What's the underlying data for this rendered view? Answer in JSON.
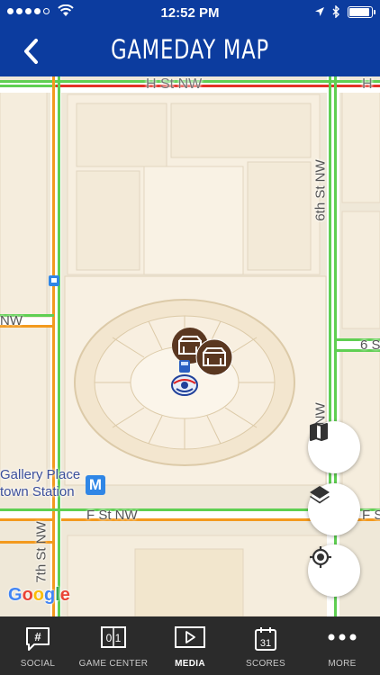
{
  "status_bar": {
    "time": "12:52 PM",
    "signal_dots_filled": 4,
    "signal_dots_total": 5,
    "battery_level": 0.9
  },
  "header": {
    "title": "GAMEDAY MAP",
    "back_icon": "chevron-left-icon",
    "background_color": "#0c3c9f"
  },
  "map": {
    "street_labels": {
      "h_st_left": "H St NW",
      "h_st_right": "H",
      "sixth_st": "6th St NW",
      "sixth_st_lower": "6th St NW",
      "sixth_st_right": "6 S",
      "nw_left": "NW",
      "f_st": "F St NW",
      "f_st_right": "F S",
      "seventh_st": "7th St NW",
      "gallery_place_1": "Gallery Place",
      "gallery_place_2": "town Station"
    },
    "metro_icon_label": "M",
    "google_logo": "Google",
    "buttons": [
      {
        "name": "map-view-button",
        "icon": "map-icon"
      },
      {
        "name": "layers-button",
        "icon": "layers-icon"
      },
      {
        "name": "my-location-button",
        "icon": "crosshair-icon"
      }
    ],
    "markers": [
      "concession-icon",
      "concession-icon",
      "team-logo-icon"
    ]
  },
  "tab_bar": {
    "tabs": [
      {
        "label": "SOCIAL",
        "icon": "hashtag-bubble-icon",
        "active": false
      },
      {
        "label": "GAME CENTER",
        "icon": "scoreboard-icon",
        "icon_text": "0 1",
        "active": false
      },
      {
        "label": "MEDIA",
        "icon": "play-icon",
        "active": true
      },
      {
        "label": "SCORES",
        "icon": "calendar-icon",
        "icon_text": "31",
        "active": false
      },
      {
        "label": "MORE",
        "icon": "more-dots-icon",
        "active": false
      }
    ]
  }
}
